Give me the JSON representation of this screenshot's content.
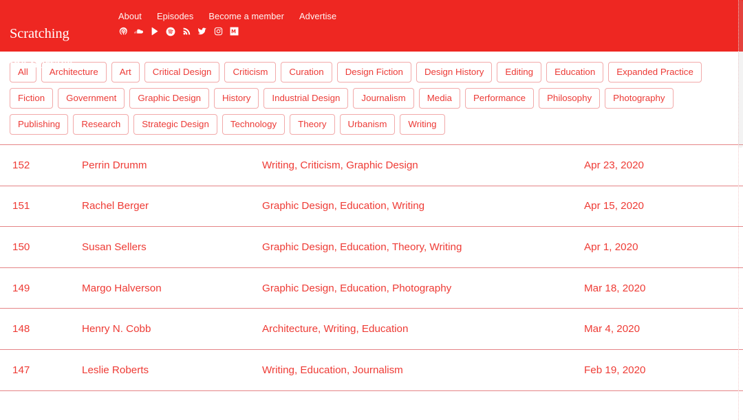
{
  "header": {
    "logo_line1": "Scratching",
    "logo_line2": "the Surface",
    "brand_color": "#ee2722",
    "nav": [
      {
        "label": "About"
      },
      {
        "label": "Episodes"
      },
      {
        "label": "Become a member"
      },
      {
        "label": "Advertise"
      }
    ],
    "social": [
      {
        "name": "apple-podcasts-icon"
      },
      {
        "name": "soundcloud-icon"
      },
      {
        "name": "google-play-icon"
      },
      {
        "name": "spotify-icon"
      },
      {
        "name": "rss-icon"
      },
      {
        "name": "twitter-icon"
      },
      {
        "name": "instagram-icon"
      },
      {
        "name": "medium-icon"
      }
    ]
  },
  "filters": {
    "accent_color": "#ec3a36",
    "border_color": "#f2a9a9",
    "rows": [
      [
        "All",
        "Architecture",
        "Art",
        "Critical Design",
        "Criticism",
        "Curation",
        "Design Fiction",
        "Design History",
        "Editing",
        "Education",
        "Expanded Practice"
      ],
      [
        "Fiction",
        "Government",
        "Graphic Design",
        "History",
        "Industrial Design",
        "Journalism",
        "Media",
        "Performance",
        "Philosophy",
        "Photography"
      ],
      [
        "Publishing",
        "Research",
        "Strategic Design",
        "Technology",
        "Theory",
        "Urbanism",
        "Writing"
      ]
    ]
  },
  "episodes": {
    "text_color": "#ee3b35",
    "divider_color": "#e58486",
    "rows": [
      {
        "number": "152",
        "guest": "Perrin Drumm",
        "tags": "Writing, Criticism, Graphic Design",
        "date": "Apr 23, 2020"
      },
      {
        "number": "151",
        "guest": "Rachel Berger",
        "tags": "Graphic Design, Education, Writing",
        "date": "Apr 15, 2020"
      },
      {
        "number": "150",
        "guest": "Susan Sellers",
        "tags": "Graphic Design, Education, Theory, Writing",
        "date": "Apr 1, 2020"
      },
      {
        "number": "149",
        "guest": "Margo Halverson",
        "tags": "Graphic Design, Education, Photography",
        "date": "Mar 18, 2020"
      },
      {
        "number": "148",
        "guest": "Henry N. Cobb",
        "tags": "Architecture, Writing, Education",
        "date": "Mar 4, 2020"
      },
      {
        "number": "147",
        "guest": "Leslie Roberts",
        "tags": "Writing, Education, Journalism",
        "date": "Feb 19, 2020"
      }
    ]
  },
  "scrollbar": {
    "visible": true
  }
}
